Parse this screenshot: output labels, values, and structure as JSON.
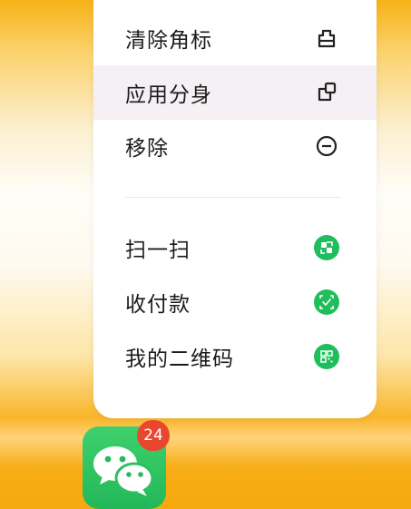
{
  "menu": {
    "items": [
      {
        "label": "清除角标",
        "icon": "clear-badge-icon"
      },
      {
        "label": "应用分身",
        "icon": "app-clone-icon"
      },
      {
        "label": "移除",
        "icon": "remove-icon"
      }
    ],
    "shortcuts": [
      {
        "label": "扫一扫",
        "icon": "scan-icon"
      },
      {
        "label": "收付款",
        "icon": "pay-receive-icon"
      },
      {
        "label": "我的二维码",
        "icon": "qr-code-icon"
      }
    ]
  },
  "app": {
    "name_icon": "wechat-icon",
    "badge_count": "24"
  },
  "colors": {
    "shortcut_green": "#1fbe5c",
    "badge_red": "#e9462f",
    "highlight": "#f4f0f4"
  }
}
